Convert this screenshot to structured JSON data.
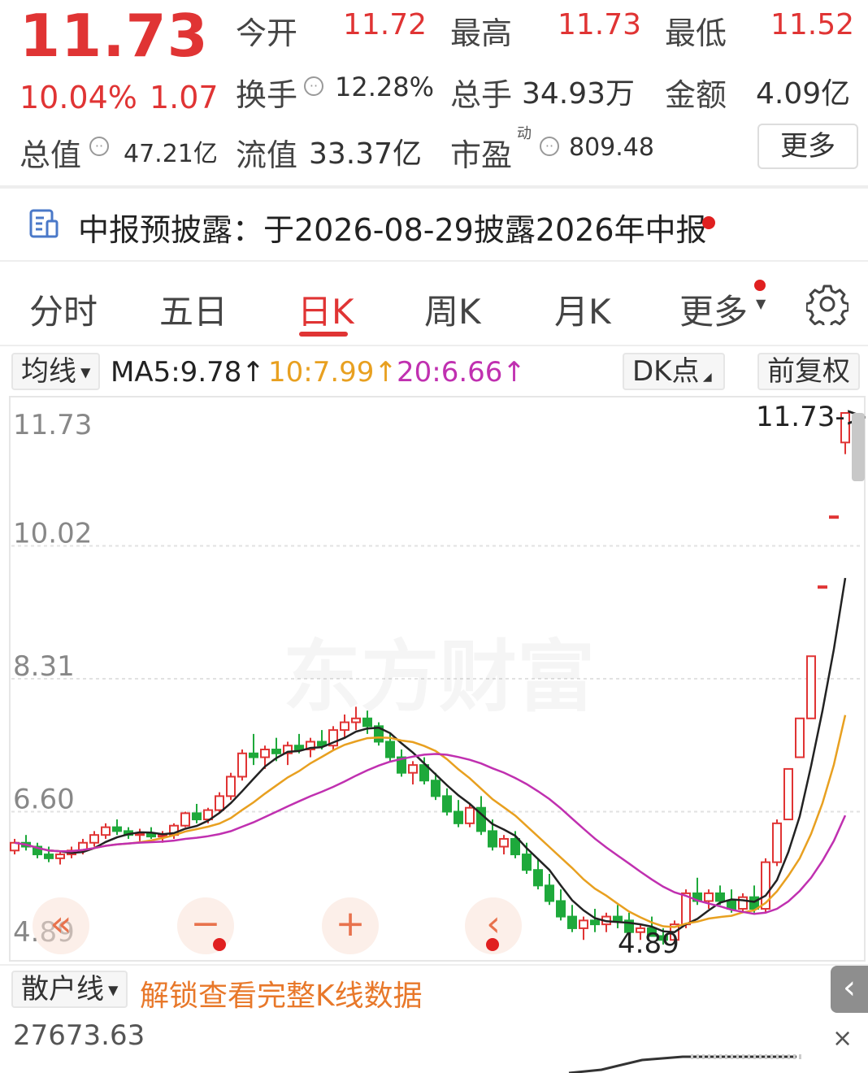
{
  "quote": {
    "price": "11.73",
    "change_pct": "10.04%",
    "change_amt": "1.07",
    "open_label": "今开",
    "open": "11.72",
    "high_label": "最高",
    "high": "11.73",
    "low_label": "最低",
    "low": "11.52",
    "turnover_label": "换手",
    "turnover": "12.28%",
    "volume_label": "总手",
    "volume": "34.93万",
    "amount_label": "金额",
    "amount": "4.09亿",
    "mktcap_label": "总值",
    "mktcap": "47.21亿",
    "float_label": "流值",
    "float": "33.37亿",
    "pe_label": "市盈",
    "pe_sup": "动",
    "pe": "809.48",
    "more": "更多"
  },
  "notice": {
    "text": "中报预披露：于2026-08-29披露2026年中报"
  },
  "tabs": [
    "分时",
    "五日",
    "日K",
    "周K",
    "月K",
    "更多"
  ],
  "active_tab": "日K",
  "ma_bar": {
    "selector": "均线",
    "ma5": "MA5:9.78",
    "ma10": "10:7.99",
    "ma20": "20:6.66",
    "dk": "DK点",
    "adjust": "前复权",
    "colors": {
      "ma5": "#222222",
      "ma10": "#e8a020",
      "ma20": "#c030b0",
      "up": "#e03434",
      "down": "#1ea93b"
    }
  },
  "chart_data": {
    "type": "candlestick",
    "y_ticks": [
      "11.73",
      "10.02",
      "8.31",
      "6.60",
      "4.89"
    ],
    "ylim": [
      4.89,
      11.73
    ],
    "last_price_label": "11.73->",
    "min_label": "4.89",
    "watermark": "东方财富",
    "candles_ohlc": [
      [
        6.1,
        6.25,
        6.05,
        6.2
      ],
      [
        6.2,
        6.3,
        6.1,
        6.15
      ],
      [
        6.15,
        6.2,
        6.0,
        6.05
      ],
      [
        6.05,
        6.15,
        5.95,
        6.0
      ],
      [
        6.0,
        6.1,
        5.92,
        6.05
      ],
      [
        6.05,
        6.15,
        6.0,
        6.1
      ],
      [
        6.1,
        6.25,
        6.05,
        6.2
      ],
      [
        6.2,
        6.35,
        6.15,
        6.3
      ],
      [
        6.3,
        6.45,
        6.25,
        6.4
      ],
      [
        6.4,
        6.5,
        6.3,
        6.35
      ],
      [
        6.35,
        6.4,
        6.25,
        6.3
      ],
      [
        6.3,
        6.38,
        6.22,
        6.32
      ],
      [
        6.32,
        6.4,
        6.25,
        6.28
      ],
      [
        6.28,
        6.35,
        6.2,
        6.3
      ],
      [
        6.3,
        6.45,
        6.25,
        6.42
      ],
      [
        6.42,
        6.6,
        6.4,
        6.58
      ],
      [
        6.58,
        6.7,
        6.45,
        6.5
      ],
      [
        6.5,
        6.65,
        6.45,
        6.62
      ],
      [
        6.62,
        6.85,
        6.58,
        6.8
      ],
      [
        6.8,
        7.1,
        6.75,
        7.05
      ],
      [
        7.05,
        7.4,
        7.0,
        7.35
      ],
      [
        7.35,
        7.6,
        7.2,
        7.3
      ],
      [
        7.3,
        7.45,
        7.15,
        7.4
      ],
      [
        7.4,
        7.55,
        7.25,
        7.35
      ],
      [
        7.35,
        7.5,
        7.2,
        7.45
      ],
      [
        7.45,
        7.6,
        7.35,
        7.4
      ],
      [
        7.4,
        7.55,
        7.3,
        7.5
      ],
      [
        7.5,
        7.65,
        7.4,
        7.45
      ],
      [
        7.45,
        7.7,
        7.4,
        7.65
      ],
      [
        7.65,
        7.85,
        7.55,
        7.75
      ],
      [
        7.75,
        7.95,
        7.65,
        7.8
      ],
      [
        7.8,
        7.9,
        7.6,
        7.7
      ],
      [
        7.7,
        7.75,
        7.45,
        7.5
      ],
      [
        7.5,
        7.6,
        7.25,
        7.3
      ],
      [
        7.3,
        7.4,
        7.05,
        7.1
      ],
      [
        7.1,
        7.25,
        6.95,
        7.2
      ],
      [
        7.2,
        7.3,
        6.95,
        7.0
      ],
      [
        7.0,
        7.1,
        6.75,
        6.8
      ],
      [
        6.8,
        6.9,
        6.55,
        6.6
      ],
      [
        6.6,
        6.75,
        6.4,
        6.45
      ],
      [
        6.45,
        6.7,
        6.4,
        6.65
      ],
      [
        6.65,
        6.8,
        6.3,
        6.35
      ],
      [
        6.35,
        6.5,
        6.1,
        6.15
      ],
      [
        6.15,
        6.3,
        6.05,
        6.25
      ],
      [
        6.25,
        6.35,
        6.0,
        6.05
      ],
      [
        6.05,
        6.2,
        5.8,
        5.85
      ],
      [
        5.85,
        6.0,
        5.6,
        5.65
      ],
      [
        5.65,
        5.8,
        5.4,
        5.45
      ],
      [
        5.45,
        5.6,
        5.2,
        5.25
      ],
      [
        5.25,
        5.4,
        5.05,
        5.1
      ],
      [
        5.1,
        5.25,
        4.95,
        5.2
      ],
      [
        5.2,
        5.35,
        5.05,
        5.15
      ],
      [
        5.15,
        5.3,
        5.05,
        5.25
      ],
      [
        5.25,
        5.4,
        5.1,
        5.2
      ],
      [
        5.2,
        5.3,
        5.0,
        5.05
      ],
      [
        5.05,
        5.15,
        4.95,
        5.1
      ],
      [
        5.1,
        5.25,
        5.0,
        5.0
      ],
      [
        5.0,
        5.1,
        4.89,
        4.95
      ],
      [
        4.95,
        5.2,
        4.92,
        5.15
      ],
      [
        5.15,
        5.6,
        5.1,
        5.55
      ],
      [
        5.55,
        5.75,
        5.4,
        5.45
      ],
      [
        5.45,
        5.6,
        5.35,
        5.55
      ],
      [
        5.55,
        5.65,
        5.4,
        5.45
      ],
      [
        5.45,
        5.6,
        5.3,
        5.35
      ],
      [
        5.35,
        5.55,
        5.3,
        5.5
      ],
      [
        5.5,
        5.65,
        5.3,
        5.35
      ],
      [
        5.35,
        6.0,
        5.3,
        5.95
      ],
      [
        5.95,
        6.5,
        5.9,
        6.45
      ],
      [
        6.5,
        7.15,
        6.5,
        7.15
      ],
      [
        7.3,
        7.8,
        7.3,
        7.8
      ],
      [
        7.8,
        8.6,
        7.8,
        8.6
      ],
      [
        9.5,
        9.5,
        9.5,
        9.5
      ],
      [
        10.4,
        10.4,
        10.4,
        10.4
      ],
      [
        11.35,
        11.73,
        11.2,
        11.73
      ]
    ]
  },
  "subbar": {
    "selector": "散户线",
    "unlock": "解锁查看完整K线数据",
    "value": "27673.63"
  }
}
